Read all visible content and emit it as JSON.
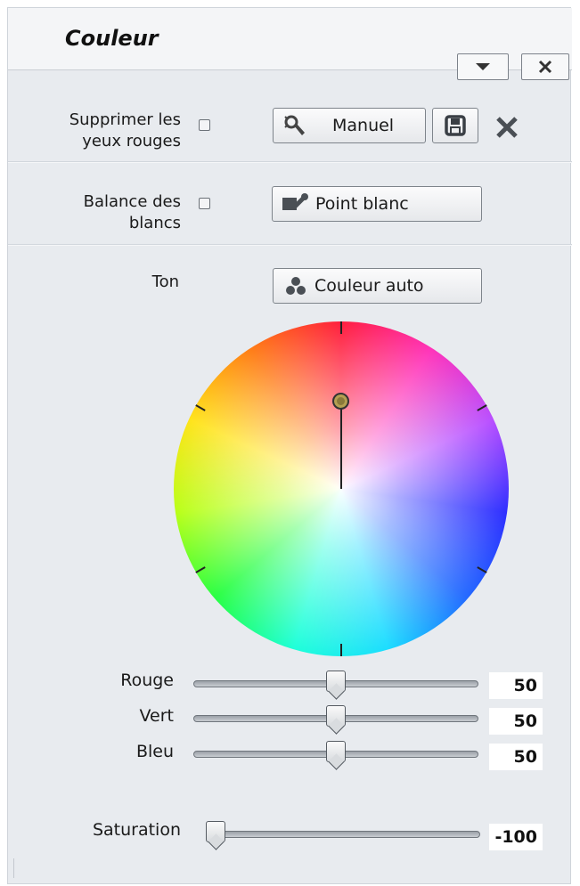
{
  "panel": {
    "title": "Couleur"
  },
  "red_eye": {
    "label": "Supprimer les\nyeux rouges",
    "checked": false,
    "manual_label": "Manuel",
    "manual_icon": "magic-wand-cursor-icon",
    "save_icon": "save-icon",
    "delete_icon": "close-x-icon"
  },
  "white_balance": {
    "label": "Balance des\nblancs",
    "checked": false,
    "button_label": "Point blanc",
    "button_icon": "eyedropper-icon"
  },
  "tone": {
    "label": "Ton",
    "button_label": "Couleur auto",
    "button_icon": "color-dots-icon"
  },
  "sliders": [
    {
      "label": "Rouge",
      "value": "50",
      "fraction": 0.5
    },
    {
      "label": "Vert",
      "value": "50",
      "fraction": 0.5
    },
    {
      "label": "Bleu",
      "value": "50",
      "fraction": 0.5
    }
  ],
  "saturation": {
    "label": "Saturation",
    "value": "-100",
    "fraction": 0.0
  },
  "colors": {
    "panel_bg": "#e8ebef",
    "accent": "#1a1a1a"
  }
}
